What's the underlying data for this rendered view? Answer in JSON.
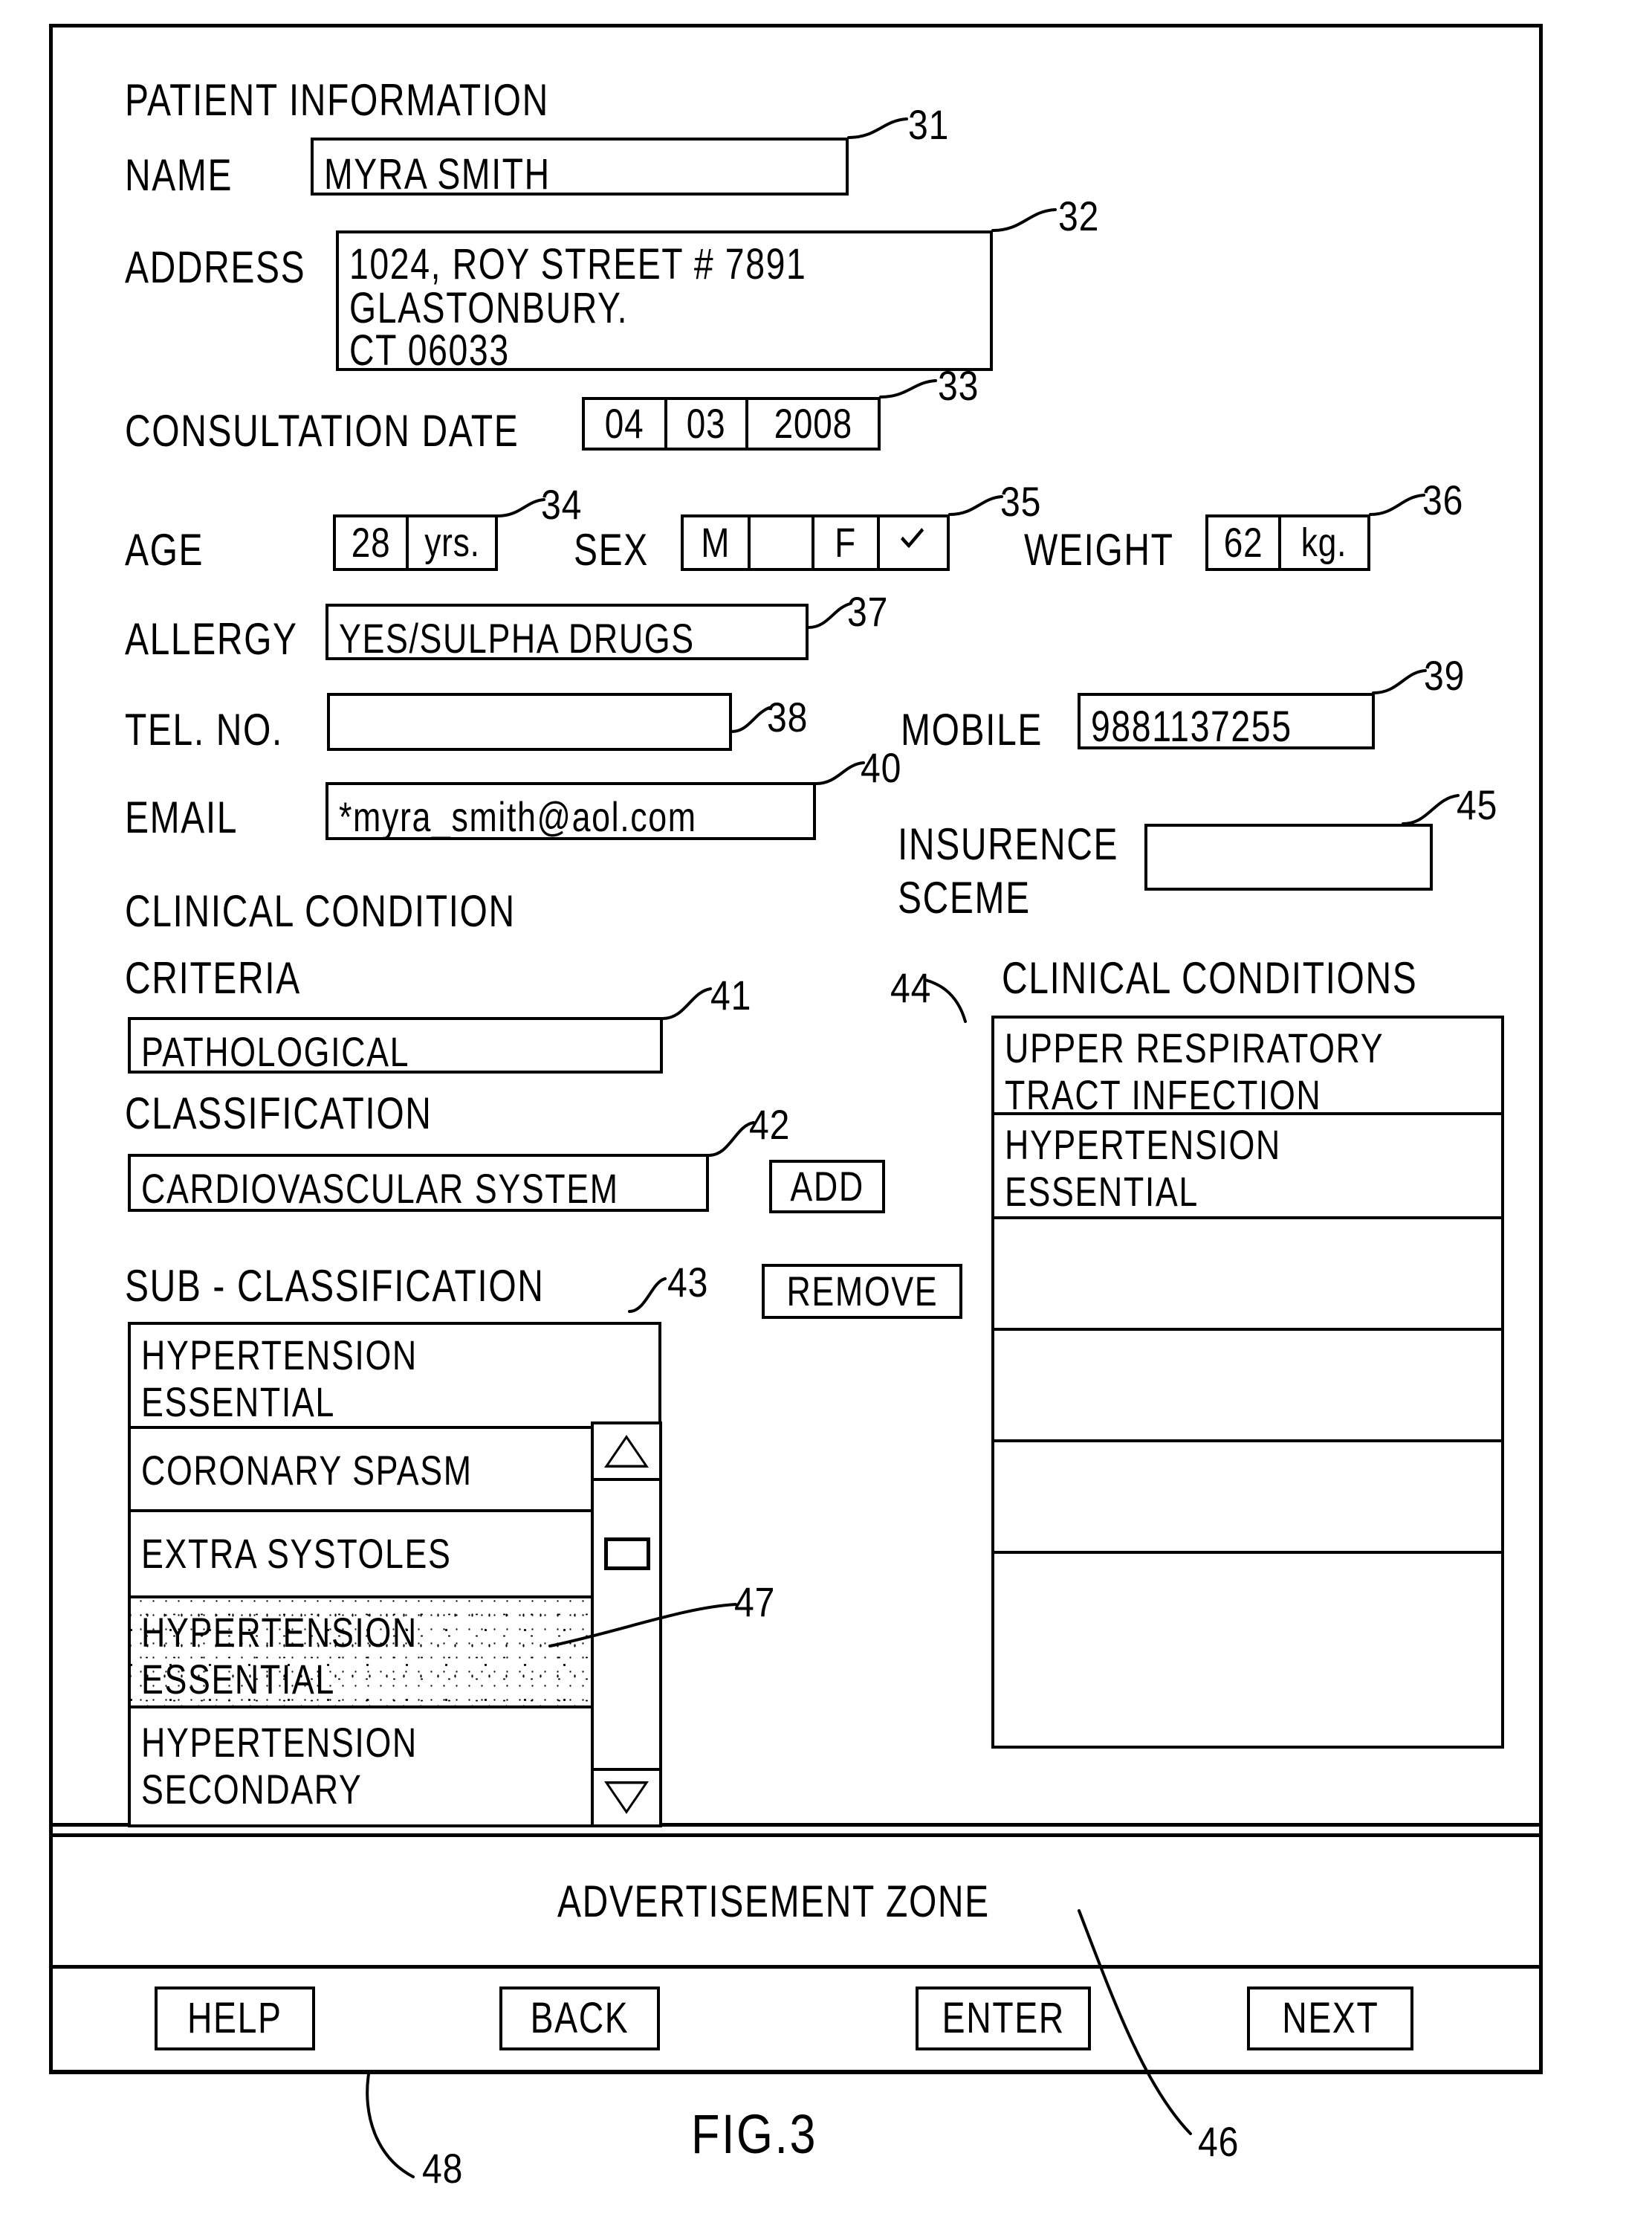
{
  "figure": {
    "caption": "FIG.3"
  },
  "patient_information": {
    "section_title": "PATIENT INFORMATION",
    "name_label": "NAME",
    "name_value": "MYRA SMITH",
    "name_ref": "31",
    "address_label": "ADDRESS",
    "address_lines": [
      "1024, ROY STREET # 7891",
      "GLASTONBURY.",
      "CT 06033"
    ],
    "address_ref": "32",
    "consultation_date_label": "CONSULTATION DATE",
    "consultation_date": {
      "day": "04",
      "month": "03",
      "year": "2008"
    },
    "consultation_date_ref": "33",
    "age_label": "AGE",
    "age_value": "28",
    "age_unit": "yrs.",
    "age_ref": "34",
    "sex_label": "SEX",
    "sex_male": "M",
    "sex_male_mark": "",
    "sex_female": "F",
    "sex_female_mark": "check-mark",
    "sex_ref": "35",
    "weight_label": "WEIGHT",
    "weight_value": "62",
    "weight_unit": "kg.",
    "weight_ref": "36",
    "allergy_label": "ALLERGY",
    "allergy_value": "YES/SULPHA DRUGS",
    "allergy_ref": "37",
    "tel_label": "TEL. NO.",
    "tel_value": "",
    "tel_ref": "38",
    "mobile_label": "MOBILE",
    "mobile_value": "9881137255",
    "mobile_ref": "39",
    "email_label": "EMAIL",
    "email_value": "*myra_smith@aol.com",
    "email_ref": "40",
    "insurance_label_line1": "INSURENCE",
    "insurance_label_line2": "SCEME",
    "insurance_value": "",
    "insurance_ref": "45"
  },
  "clinical_condition": {
    "section_title": "CLINICAL CONDITION",
    "criteria_label": "CRITERIA",
    "criteria_value": "PATHOLOGICAL",
    "criteria_ref": "41",
    "classification_label": "CLASSIFICATION",
    "classification_value": "CARDIOVASCULAR SYSTEM",
    "classification_ref": "42",
    "add_button": "ADD",
    "remove_button": "REMOVE",
    "sub_classification_label": "SUB - CLASSIFICATION",
    "sub_classification_ref": "43",
    "sub_classification_items": [
      {
        "lines": [
          "HYPERTENSION",
          "ESSENTIAL"
        ],
        "selected": false
      },
      {
        "lines": [
          "CORONARY SPASM"
        ],
        "selected": false
      },
      {
        "lines": [
          "EXTRA SYSTOLES"
        ],
        "selected": false
      },
      {
        "lines": [
          "HYPERTENSION",
          "ESSENTIAL"
        ],
        "selected": true
      },
      {
        "lines": [
          "HYPERTENSION",
          "SECONDARY"
        ],
        "selected": false
      }
    ],
    "selected_item_ref": "47",
    "scrollbar": {
      "up_arrow_icon": "triangle-up-icon",
      "down_arrow_icon": "triangle-down-icon",
      "thumb_icon": "scrollbar-thumb"
    },
    "clinical_conditions_label": "CLINICAL CONDITIONS",
    "clinical_conditions_ref": "44",
    "clinical_conditions_items": [
      {
        "lines": [
          "UPPER RESPIRATORY",
          "TRACT INFECTION"
        ]
      },
      {
        "lines": [
          "HYPERTENSION",
          "ESSENTIAL"
        ]
      },
      {
        "lines": [
          ""
        ]
      },
      {
        "lines": [
          ""
        ]
      },
      {
        "lines": [
          ""
        ]
      },
      {
        "lines": [
          ""
        ]
      }
    ]
  },
  "advertisement": {
    "label": "ADVERTISEMENT ZONE",
    "ref": "46"
  },
  "button_bar": {
    "ref": "48",
    "buttons": [
      {
        "label": "HELP"
      },
      {
        "label": "BACK"
      },
      {
        "label": "ENTER"
      },
      {
        "label": "NEXT"
      }
    ]
  }
}
